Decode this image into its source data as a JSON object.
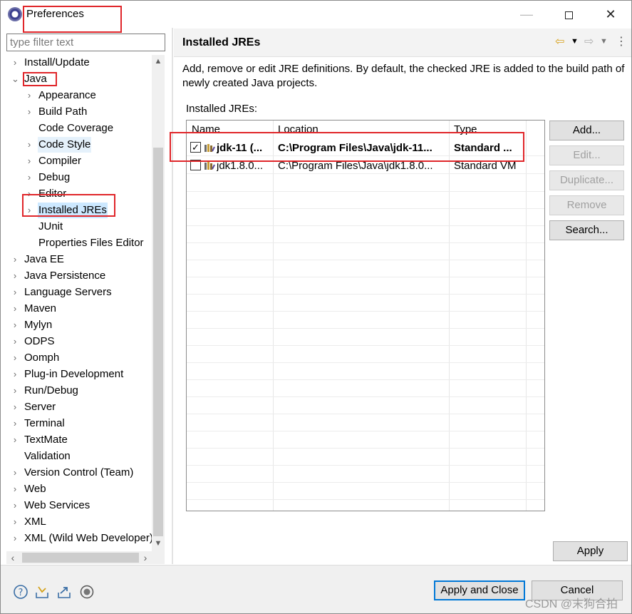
{
  "window": {
    "title": "Preferences"
  },
  "filter": {
    "placeholder": "type filter text"
  },
  "tree": [
    {
      "label": "Install/Update",
      "expander": "›"
    },
    {
      "label": "Java",
      "expander": "⌄"
    },
    {
      "label": "Appearance",
      "expander": "›"
    },
    {
      "label": "Build Path",
      "expander": "›"
    },
    {
      "label": "Code Coverage",
      "expander": ""
    },
    {
      "label": "Code Style",
      "expander": "›"
    },
    {
      "label": "Compiler",
      "expander": "›"
    },
    {
      "label": "Debug",
      "expander": "›"
    },
    {
      "label": "Editor",
      "expander": "›"
    },
    {
      "label": "Installed JREs",
      "expander": "›"
    },
    {
      "label": "JUnit",
      "expander": ""
    },
    {
      "label": "Properties Files Editor",
      "expander": ""
    },
    {
      "label": "Java EE",
      "expander": "›"
    },
    {
      "label": "Java Persistence",
      "expander": "›"
    },
    {
      "label": "Language Servers",
      "expander": "›"
    },
    {
      "label": "Maven",
      "expander": "›"
    },
    {
      "label": "Mylyn",
      "expander": "›"
    },
    {
      "label": "ODPS",
      "expander": "›"
    },
    {
      "label": "Oomph",
      "expander": "›"
    },
    {
      "label": "Plug-in Development",
      "expander": "›"
    },
    {
      "label": "Run/Debug",
      "expander": "›"
    },
    {
      "label": "Server",
      "expander": "›"
    },
    {
      "label": "Terminal",
      "expander": "›"
    },
    {
      "label": "TextMate",
      "expander": "›"
    },
    {
      "label": "Validation",
      "expander": ""
    },
    {
      "label": "Version Control (Team)",
      "expander": "›"
    },
    {
      "label": "Web",
      "expander": "›"
    },
    {
      "label": "Web Services",
      "expander": "›"
    },
    {
      "label": "XML",
      "expander": "›"
    },
    {
      "label": "XML (Wild Web Developer)",
      "expander": "›"
    }
  ],
  "page": {
    "title": "Installed JREs",
    "description": "Add, remove or edit JRE definitions. By default, the checked JRE is added to the build path of newly created Java projects.",
    "table_label": "Installed JREs:",
    "columns": [
      "Name",
      "Location",
      "Type"
    ],
    "rows": [
      {
        "checked": true,
        "name": "jdk-11 (...",
        "location": "C:\\Program Files\\Java\\jdk-11...",
        "type": "Standard ..."
      },
      {
        "checked": false,
        "name": "jdk1.8.0...",
        "location": "C:\\Program Files\\Java\\jdk1.8.0...",
        "type": "Standard VM"
      }
    ],
    "buttons": {
      "add": "Add...",
      "edit": "Edit...",
      "duplicate": "Duplicate...",
      "remove": "Remove",
      "search": "Search..."
    },
    "apply": "Apply"
  },
  "footer": {
    "apply_close": "Apply and Close",
    "cancel": "Cancel"
  },
  "watermark": "CSDN @末狗合拍",
  "colors": {
    "selection": "#cce8ff",
    "annotation": "#e0262a",
    "focus": "#0078d7"
  }
}
